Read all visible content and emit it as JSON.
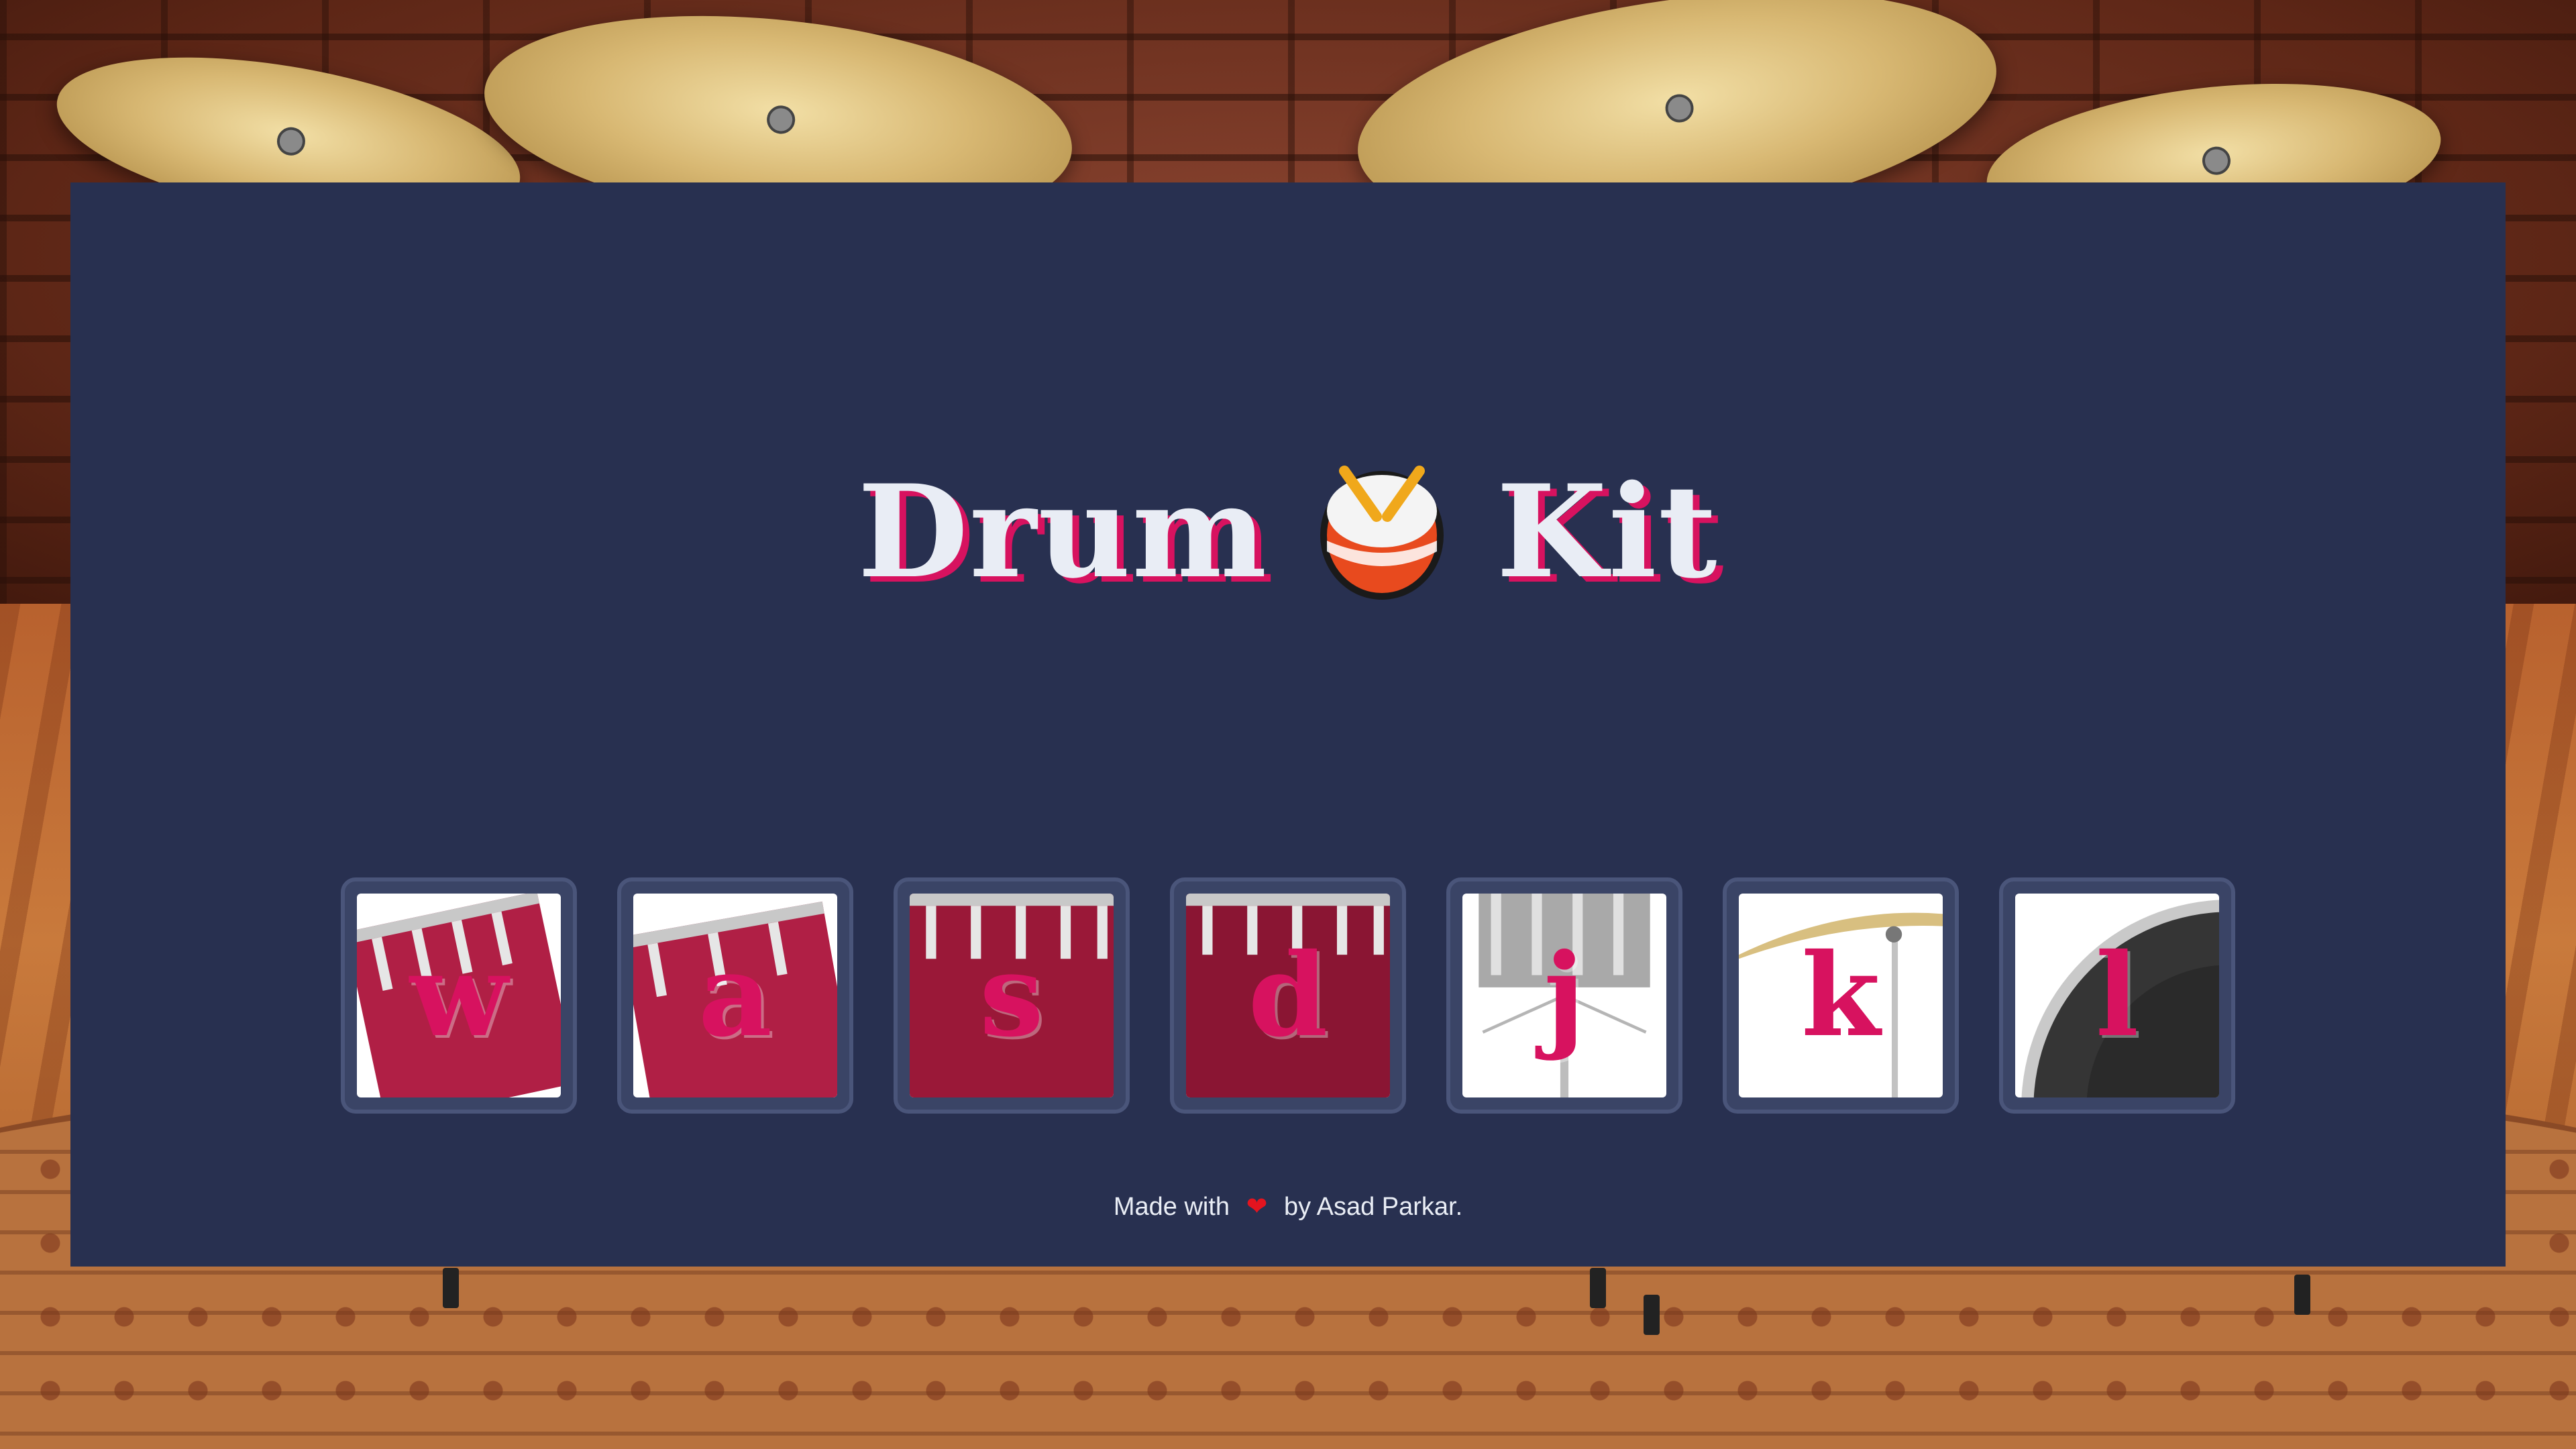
{
  "header": {
    "title_left": "Drum",
    "title_right": "Kit",
    "title_icon": "drum-emoji"
  },
  "keys": [
    {
      "letter": "w",
      "instrument": "tom-1"
    },
    {
      "letter": "a",
      "instrument": "tom-2"
    },
    {
      "letter": "s",
      "instrument": "tom-3"
    },
    {
      "letter": "d",
      "instrument": "tom-4"
    },
    {
      "letter": "j",
      "instrument": "snare"
    },
    {
      "letter": "k",
      "instrument": "crash"
    },
    {
      "letter": "l",
      "instrument": "kick"
    }
  ],
  "footer": {
    "prefix": "Made with",
    "heart_icon": "heart-icon",
    "suffix": "by Asad Parkar."
  },
  "colors": {
    "panel": "#283050",
    "accent": "#d7125f",
    "text": "#e9edf5",
    "key_frame": "#3a4466"
  }
}
